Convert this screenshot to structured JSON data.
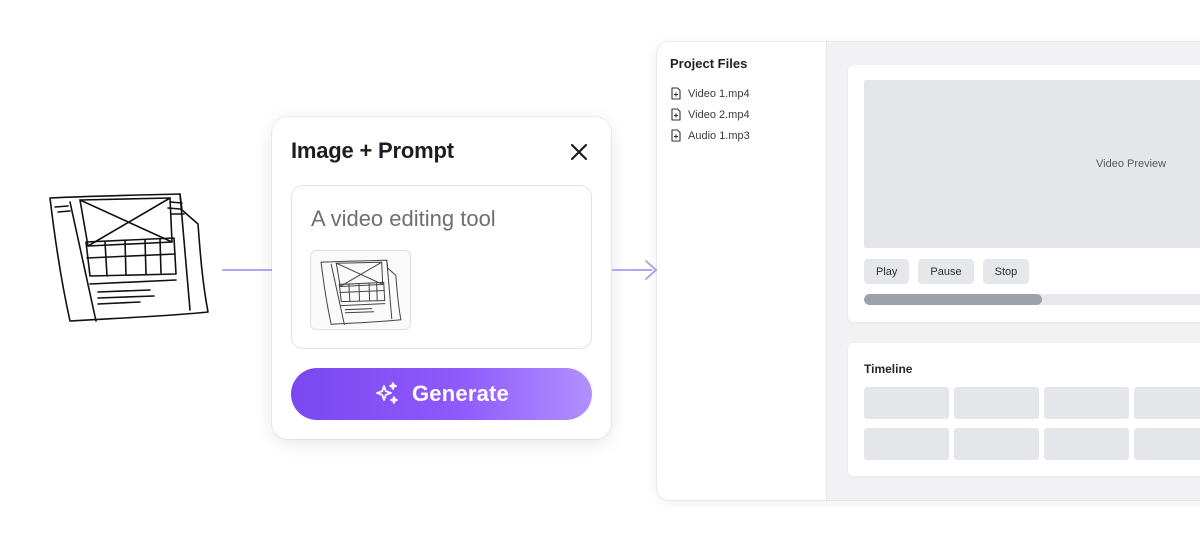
{
  "prompt_card": {
    "title": "Image + Prompt",
    "prompt_text": "A video editing tool",
    "generate_label": "Generate",
    "close_icon": "close-icon",
    "sparkle_icon": "sparkles-icon"
  },
  "sidebar": {
    "title": "Project Files",
    "files": [
      {
        "name": "Video 1.mp4"
      },
      {
        "name": "Video 2.mp4"
      },
      {
        "name": "Audio 1.mp3"
      }
    ]
  },
  "preview": {
    "label": "Video Preview",
    "controls": {
      "play": "Play",
      "pause": "Pause",
      "stop": "Stop"
    },
    "progress": 0.48
  },
  "timeline": {
    "title": "Timeline",
    "rows": 2,
    "columns": 4
  },
  "colors": {
    "accent": "#8b55f7",
    "connector": "#b7a6f3"
  }
}
